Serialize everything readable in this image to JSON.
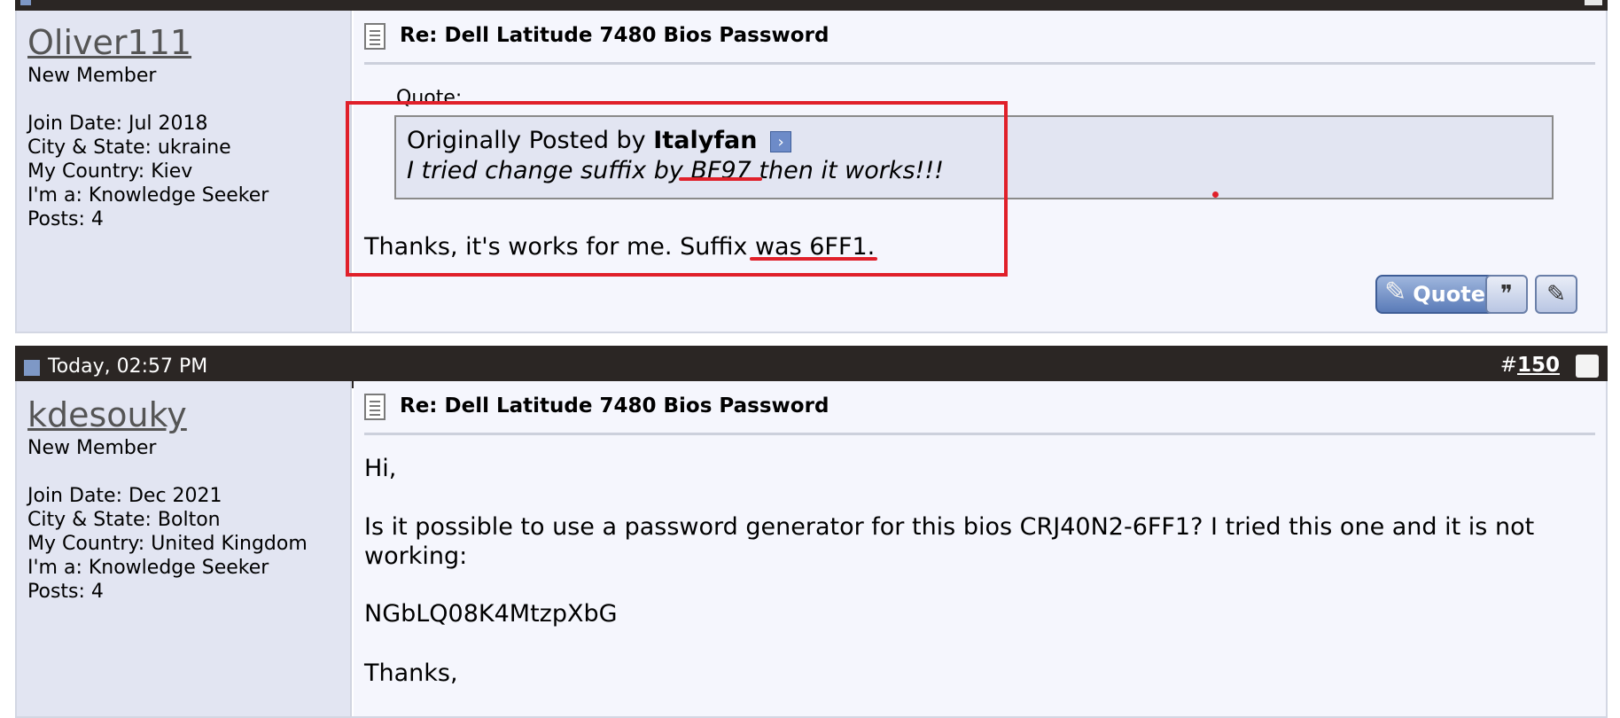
{
  "post1": {
    "username": "Oliver111",
    "user_title": "New Member",
    "info": [
      "Join Date: Jul 2018",
      "City & State: ukraine",
      "My Country: Kiev",
      "I'm a: Knowledge Seeker",
      "Posts: 4"
    ],
    "title": "Re: Dell Latitude 7480 Bios Password",
    "quote_label": "Quote:",
    "quote_prefix": "Originally Posted by",
    "quote_author": "Italyfan",
    "quote_text": "I tried change suffix by BF97 then it works!!!",
    "message": "Thanks, it's works for me. Suffix was 6FF1.",
    "quote_button": "Quote",
    "annotation_color": "#e0202a"
  },
  "post2": {
    "date": "Today, 02:57 PM",
    "hash": "#",
    "number": "150",
    "username": "kdesouky",
    "user_title": "New Member",
    "info": [
      "Join Date: Dec 2021",
      "City & State: Bolton",
      "My Country: United Kingdom",
      "I'm a: Knowledge Seeker",
      "Posts: 4"
    ],
    "title": "Re: Dell Latitude 7480 Bios Password",
    "lines": [
      "Hi,",
      "Is it possible to use a password generator for this bios CRJ40N2-6FF1? I tried this one and it is not",
      "working:",
      "NGbLQ08K4MtzpXbG",
      "Thanks,"
    ]
  },
  "colors": {
    "header_bg": "#2b2624",
    "user_panel_bg": "#e2e5f2",
    "content_bg": "#f5f6fd",
    "quote_bg": "#e2e5f2"
  }
}
